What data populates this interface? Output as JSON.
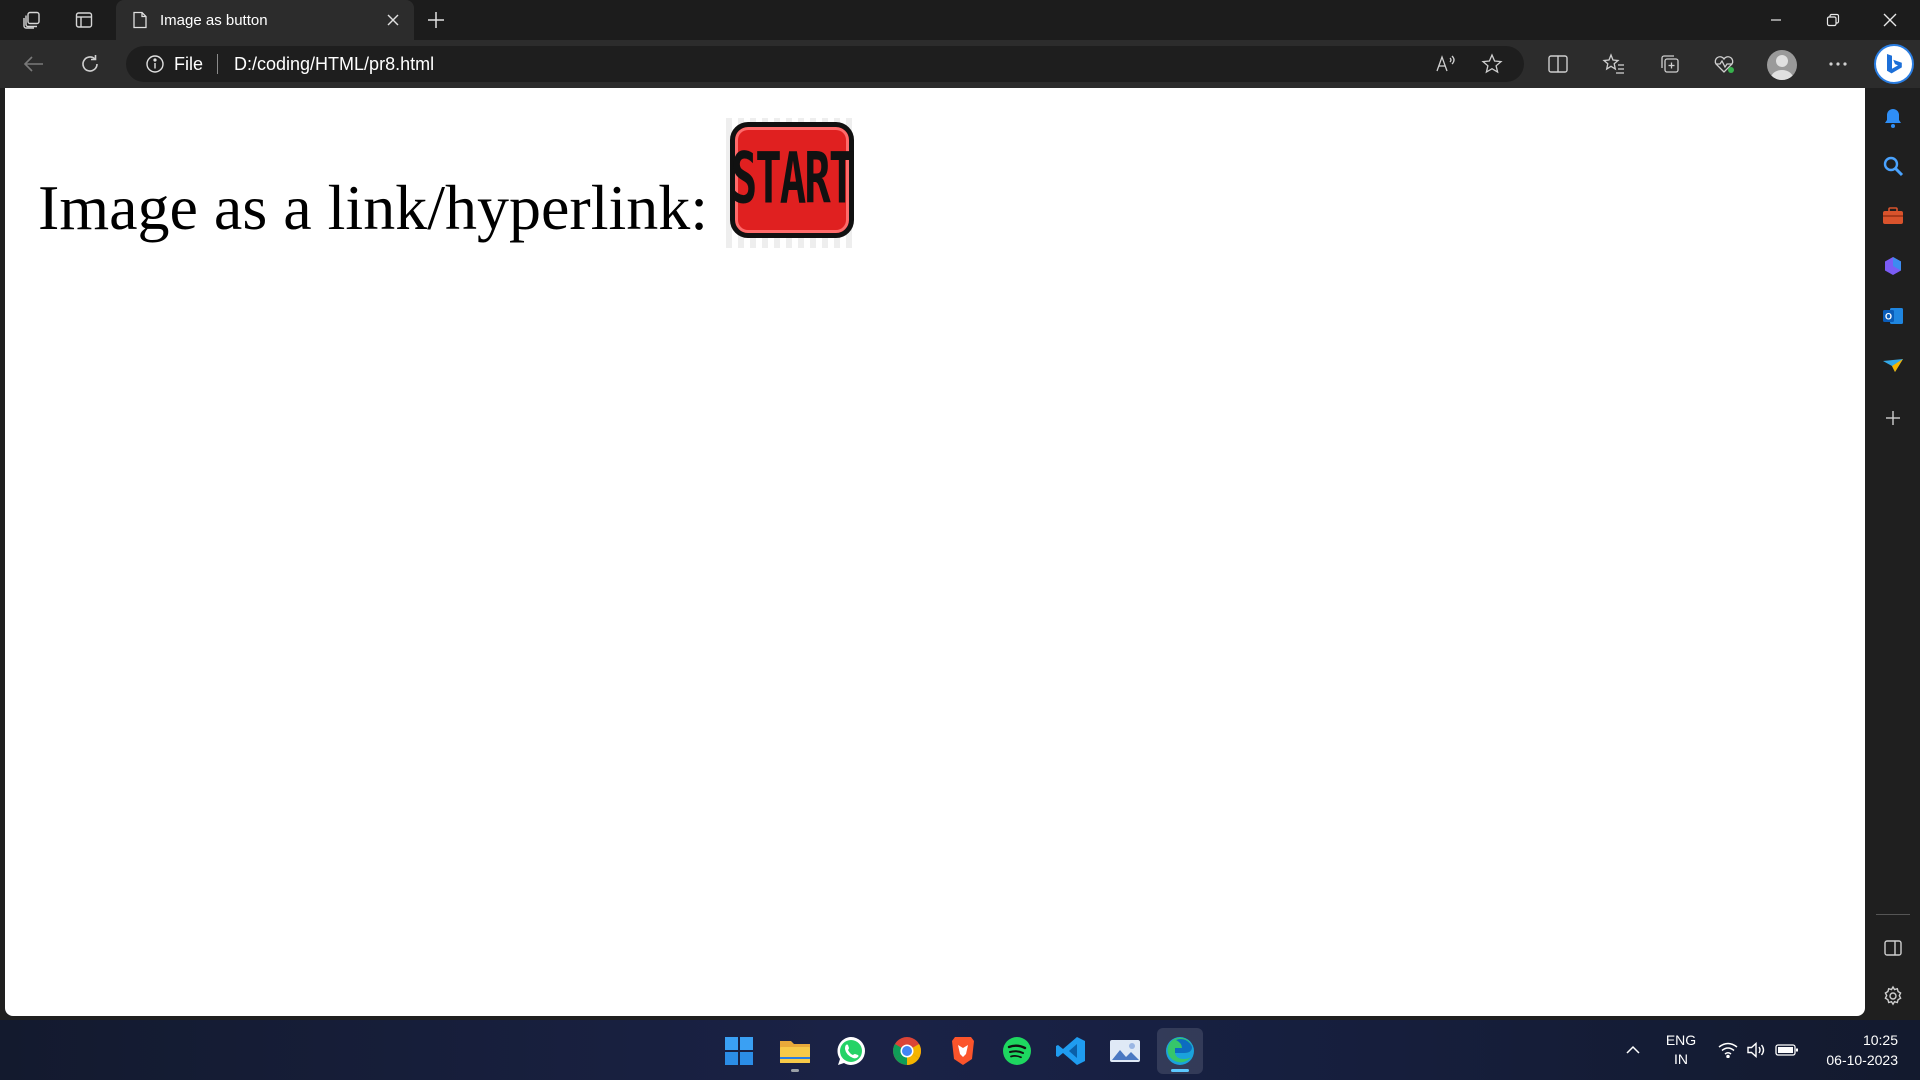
{
  "tab": {
    "title": "Image as button"
  },
  "address": {
    "scheme": "File",
    "url": "D:/coding/HTML/pr8.html"
  },
  "page": {
    "text": "Image as a link/hyperlink:",
    "image_label": "START"
  },
  "tray": {
    "lang_top": "ENG",
    "lang_bottom": "IN",
    "time": "10:25",
    "date": "06-10-2023"
  },
  "colors": {
    "accent": "#2a7de1",
    "start_red": "#e02020"
  },
  "taskbar_apps": [
    "start-menu",
    "file-explorer",
    "whatsapp",
    "chrome",
    "brave",
    "spotify",
    "vscode",
    "photos",
    "edge"
  ]
}
